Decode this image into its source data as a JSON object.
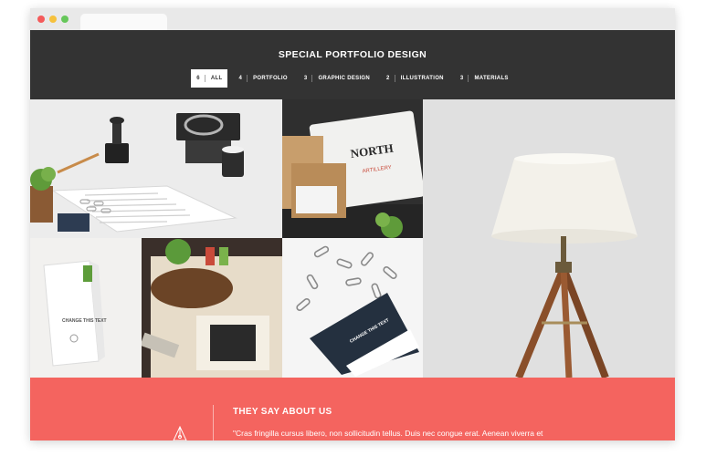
{
  "section": {
    "title": "SPECIAL PORTFOLIO DESIGN"
  },
  "filters": [
    {
      "count": "6",
      "label": "ALL",
      "active": true
    },
    {
      "count": "4",
      "label": "PORTFOLIO"
    },
    {
      "count": "3",
      "label": "GRAPHIC DESIGN"
    },
    {
      "count": "2",
      "label": "ILLUSTRATION"
    },
    {
      "count": "3",
      "label": "MATERIALS"
    }
  ],
  "portfolio_items": [
    {
      "name": "stationery-mockup"
    },
    {
      "name": "north-artillery-branding",
      "text_line1": "NORTH",
      "text_line2": "ARTILLERY"
    },
    {
      "name": "tripod-lamp"
    },
    {
      "name": "coffee-bag-mockup",
      "text": "CHANGE THIS TEXT"
    },
    {
      "name": "desk-illustration"
    },
    {
      "name": "paperclip-tag-mockup",
      "text": "CHANGE THIS TEXT"
    }
  ],
  "testimonial": {
    "title": "THEY SAY ABOUT US",
    "quote": "\"Cras fringilla cursus libero, non sollicitudin tellus. Duis nec congue erat. Aenean viverra et"
  },
  "colors": {
    "header_bg": "#333333",
    "accent": "#f4645f"
  }
}
